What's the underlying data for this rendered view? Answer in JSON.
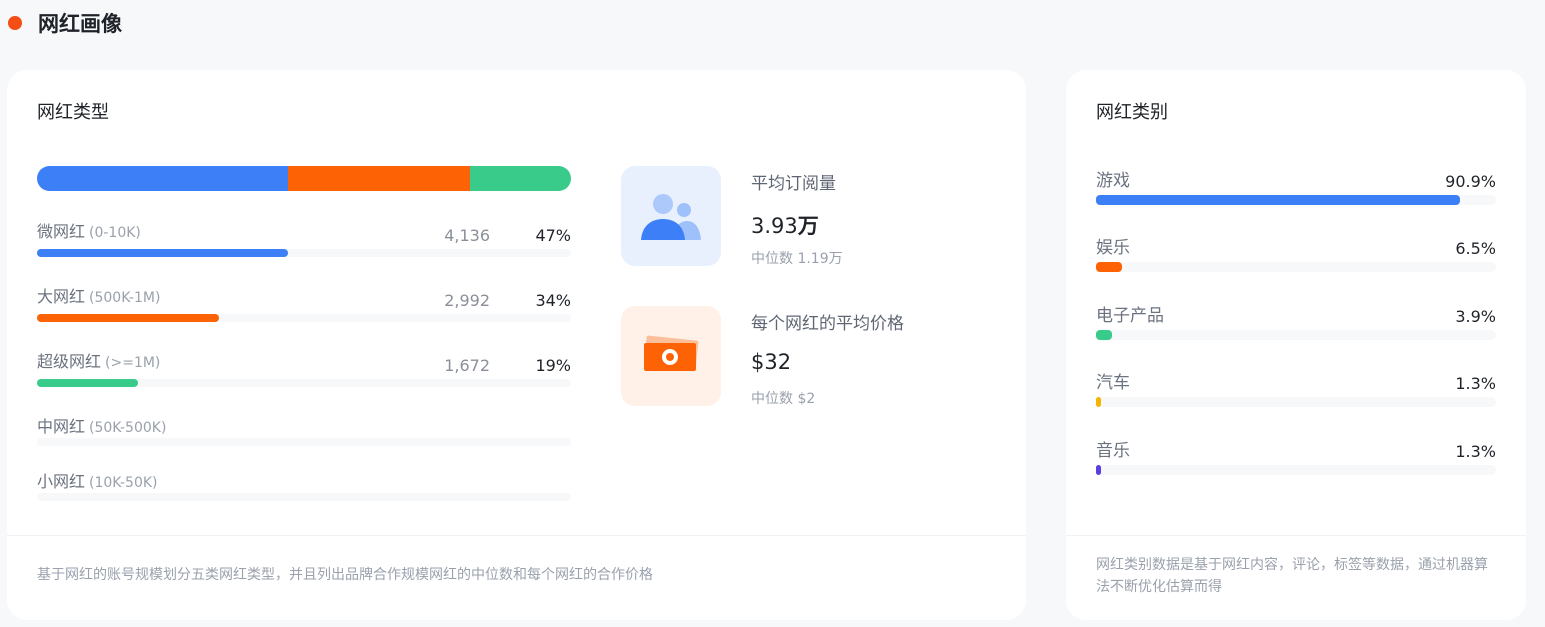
{
  "header": {
    "title": "网红画像",
    "accent_color": "#f44d16"
  },
  "influencer_types": {
    "title": "网红类型",
    "stack": [
      {
        "share": 0.47,
        "color": "#3c7ff6"
      },
      {
        "share": 0.34,
        "color": "#fd6304"
      },
      {
        "share": 0.19,
        "color": "#38cb89"
      }
    ],
    "rows": [
      {
        "name": "微网红",
        "range": "(0-10K)",
        "count": "4,136",
        "percent": "47%",
        "fill": 0.47,
        "color": "#3c7ff6"
      },
      {
        "name": "大网红",
        "range": "(500K-1M)",
        "count": "2,992",
        "percent": "34%",
        "fill": 0.34,
        "color": "#fd6304"
      },
      {
        "name": "超级网红",
        "range": "(>=1M)",
        "count": "1,672",
        "percent": "19%",
        "fill": 0.19,
        "color": "#38cb89"
      },
      {
        "name": "中网红",
        "range": "(50K-500K)",
        "count": "",
        "percent": "",
        "fill": 0,
        "color": "#3c7ff6"
      },
      {
        "name": "小网红",
        "range": "(10K-50K)",
        "count": "",
        "percent": "",
        "fill": 0,
        "color": "#3c7ff6"
      }
    ],
    "avg_subscribers": {
      "label": "平均订阅量",
      "value_number": "3.93",
      "value_unit": "万",
      "median": "中位数 1.19万",
      "icon": "users-icon"
    },
    "avg_price": {
      "label": "每个网红的平均价格",
      "value": "$32",
      "median": "中位数 $2",
      "icon": "money-icon"
    },
    "footnote": "基于网红的账号规模划分五类网红类型，并且列出品牌合作规模网红的中位数和每个网红的合作价格"
  },
  "influencer_categories": {
    "title": "网红类别",
    "rows": [
      {
        "name": "游戏",
        "percent": "90.9%",
        "fill": 0.909,
        "color": "#3c7ff6"
      },
      {
        "name": "娱乐",
        "percent": "6.5%",
        "fill": 0.065,
        "color": "#fd6304"
      },
      {
        "name": "电子产品",
        "percent": "3.9%",
        "fill": 0.039,
        "color": "#38cb89"
      },
      {
        "name": "汽车",
        "percent": "1.3%",
        "fill": 0.013,
        "color": "#f5b400"
      },
      {
        "name": "音乐",
        "percent": "1.3%",
        "fill": 0.013,
        "color": "#5b3fe0"
      }
    ],
    "footnote": "网红类别数据是基于网红内容，评论，标签等数据，通过机器算法不断优化估算而得"
  }
}
